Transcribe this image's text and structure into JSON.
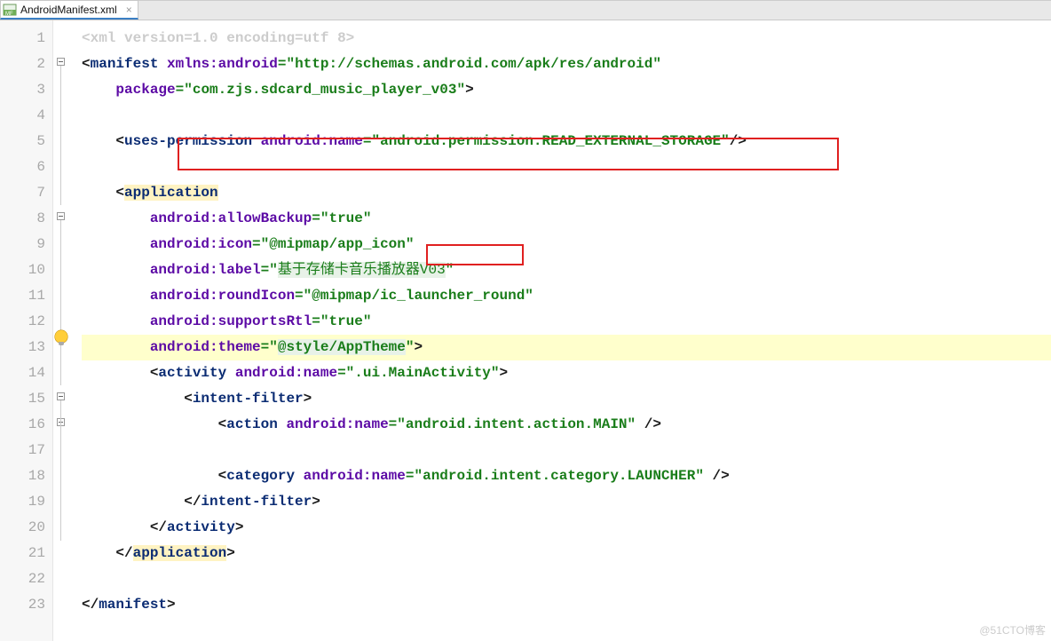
{
  "tab": {
    "filename": "AndroidManifest.xml",
    "icon": "mf-file-icon"
  },
  "gutter": {
    "lines": [
      "1",
      "2",
      "3",
      "4",
      "5",
      "6",
      "7",
      "8",
      "9",
      "10",
      "11",
      "12",
      "13",
      "14",
      "15",
      "16",
      "17",
      "18",
      "19",
      "20",
      "21",
      "22",
      "23"
    ]
  },
  "code": {
    "l1_a": "<xml version=",
    "l1_b": "1.0",
    "l1_c": " encoding=",
    "l1_d": "utf 8",
    "l1_e": ">",
    "l2_a": "<",
    "l2_tag": "manifest",
    "l2_sp": " ",
    "l2_ns": "xmlns:",
    "l2_attr": "android",
    "l2_eq": "=",
    "l2_val": "\"http://schemas.android.com/apk/res/android\"",
    "l3_attr": "package",
    "l3_eq": "=",
    "l3_val": "\"com.zjs.sdcard_music_player_v03\"",
    "l3_end": ">",
    "l5_open": "<",
    "l5_tag": "uses-permission",
    "l5_ns": "android:",
    "l5_attr": "name",
    "l5_eq": "=",
    "l5_val": "\"android.permission.READ_EXTERNAL_STORAGE\"",
    "l5_close": "/>",
    "l7_open": "<",
    "l7_tag": "application",
    "l8_ns": "android:",
    "l8_attr": "allowBackup",
    "l8_eq": "=",
    "l8_val": "\"true\"",
    "l9_ns": "android:",
    "l9_attr": "icon",
    "l9_eq": "=",
    "l9_q": "\"",
    "l9_v1": "@mipmap",
    "l9_v2": "/app_icon",
    "l9_q2": "\"",
    "l10_ns": "android:",
    "l10_attr": "label",
    "l10_eq": "=",
    "l10_q": "\"",
    "l10_val": "基于存储卡音乐播放器V03",
    "l10_q2": "\"",
    "l11_ns": "android:",
    "l11_attr": "roundIcon",
    "l11_eq": "=",
    "l11_val": "\"@mipmap/ic_launcher_round\"",
    "l12_ns": "android:",
    "l12_attr": "supportsRtl",
    "l12_eq": "=",
    "l12_val": "\"true\"",
    "l13_ns": "android:",
    "l13_attr": "theme",
    "l13_eq": "=",
    "l13_q": "\"",
    "l13_v1": "@s",
    "l13_v2": "tyle/AppTheme",
    "l13_q2": "\"",
    "l13_end": ">",
    "l14_open": "<",
    "l14_tag": "activity",
    "l14_ns": "android:",
    "l14_attr": "name",
    "l14_eq": "=",
    "l14_val": "\".ui.MainActivity\"",
    "l14_end": ">",
    "l15_open": "<",
    "l15_tag": "intent-filter",
    "l15_end": ">",
    "l16_open": "<",
    "l16_tag": "action",
    "l16_ns": "android:",
    "l16_attr": "name",
    "l16_eq": "=",
    "l16_val": "\"android.intent.action.MAIN\"",
    "l16_close": " />",
    "l18_open": "<",
    "l18_tag": "category",
    "l18_ns": "android:",
    "l18_attr": "name",
    "l18_eq": "=",
    "l18_val": "\"android.intent.category.LAUNCHER\"",
    "l18_close": " />",
    "l19_open": "</",
    "l19_tag": "intent-filter",
    "l19_end": ">",
    "l20_open": "</",
    "l20_tag": "activity",
    "l20_end": ">",
    "l21_open": "</",
    "l21_tag": "application",
    "l21_end": ">",
    "l23_open": "</",
    "l23_tag": "manifest",
    "l23_end": ">"
  },
  "watermark": "@51CTO博客"
}
